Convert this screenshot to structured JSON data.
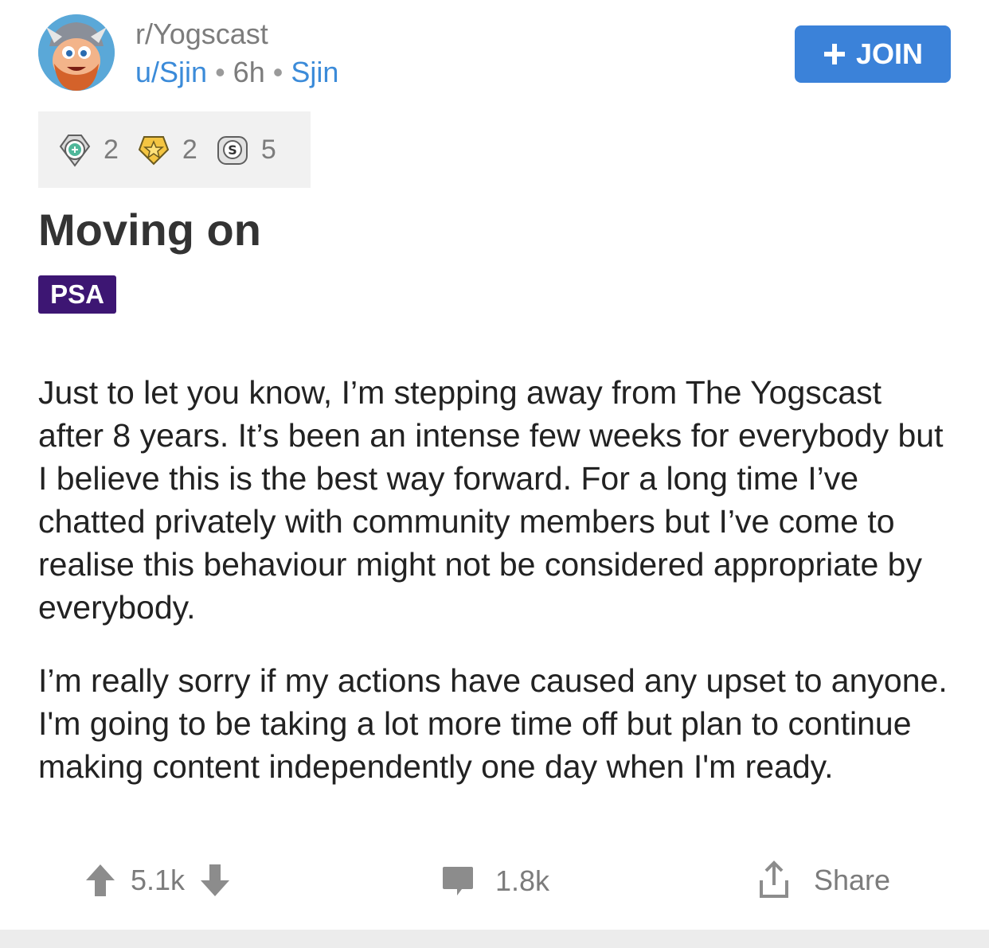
{
  "header": {
    "subreddit": "r/Yogscast",
    "user": "u/Sjin",
    "time": "6h",
    "user_flair": "Sjin",
    "join_label": "JOIN"
  },
  "awards": [
    {
      "icon": "platinum-award-icon",
      "count": "2"
    },
    {
      "icon": "gold-award-icon",
      "count": "2"
    },
    {
      "icon": "silver-award-icon",
      "count": "5"
    }
  ],
  "post": {
    "title": "Moving on",
    "flair": "PSA",
    "paragraphs": [
      "Just to let you know, I’m stepping away from The Yogscast after 8 years. It’s been an intense few weeks for everybody but I believe this is the best way forward. For a long time I’ve chatted privately with community members but I’ve come to realise this behaviour might not be considered appropriate by everybody.",
      "I’m really sorry if my actions have caused any upset to anyone. I'm going to be taking a lot more time off but plan to continue making content independently one day when I'm ready."
    ]
  },
  "actions": {
    "score": "5.1k",
    "comments": "1.8k",
    "share_label": "Share"
  },
  "colors": {
    "join_button": "#3b82d9",
    "flair_bg": "#3d1673",
    "link_blue": "#3b8bd9",
    "muted": "#7c7c7c"
  }
}
